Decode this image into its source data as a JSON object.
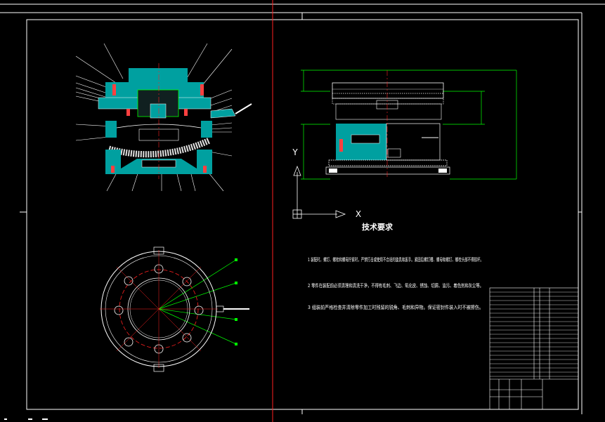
{
  "drawing": {
    "title_block_name": "",
    "tech_requirements": {
      "heading": "技术要求",
      "items": [
        "1 装配时，螺钉、螺栓和螺母拧紧时，严禁打击或使用不合适的旋具和扳手。紧固后螺钉槽、螺母和螺钉、螺栓头部不得损坏。",
        "2 零件在装配前必须清理和清洗干净，不得有毛刺、飞边、氧化皮、锈蚀、切屑、油污、着色剂和灰尘等。",
        "3 组装前严格检查并清除零件加工时残留的锐角、毛刺和异物。保证密封件装入时不被擦伤。"
      ]
    },
    "axis_labels": {
      "y": "Y",
      "x": "X"
    }
  },
  "colors": {
    "background": "#000000",
    "frame": "#ffffff",
    "center_line": "#ff2020",
    "part_fill": "#00a0a0",
    "dimension": "#00ff00",
    "spring": "#e0e0e0"
  }
}
